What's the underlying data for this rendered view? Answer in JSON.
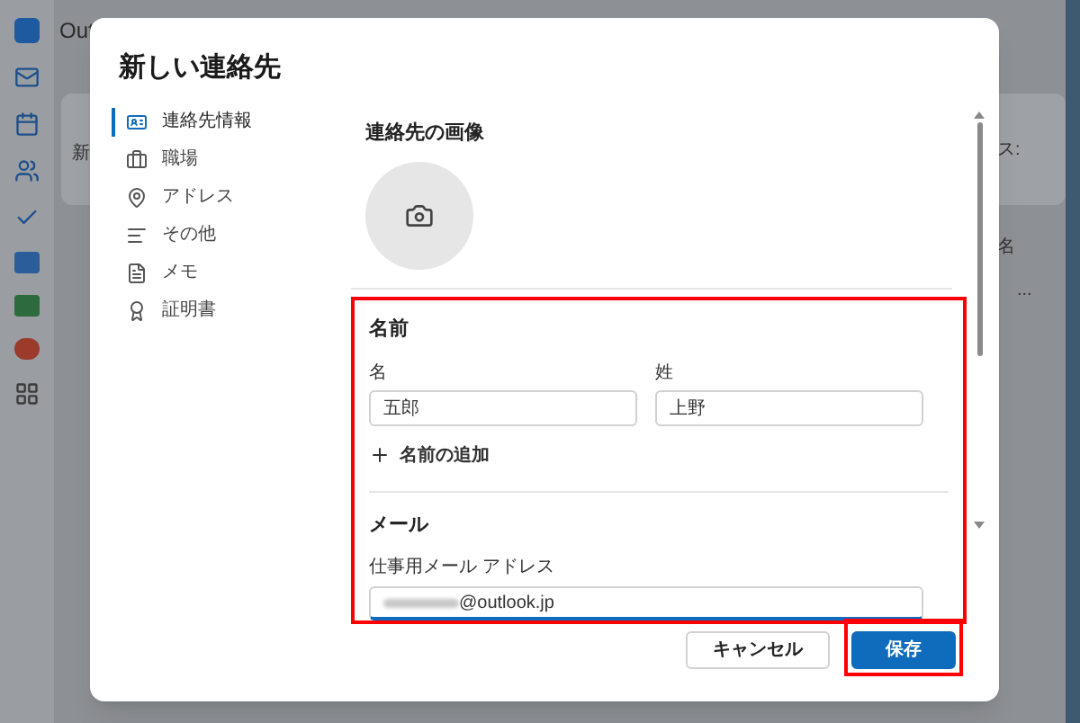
{
  "background": {
    "app_title": "Out",
    "texts": [
      "新",
      "ス:",
      "名",
      "..."
    ]
  },
  "dialog": {
    "title": "新しい連絡先",
    "nav": [
      {
        "label": "連絡先情報",
        "selected": true
      },
      {
        "label": "職場",
        "selected": false
      },
      {
        "label": "アドレス",
        "selected": false
      },
      {
        "label": "その他",
        "selected": false
      },
      {
        "label": "メモ",
        "selected": false
      },
      {
        "label": "証明書",
        "selected": false
      }
    ],
    "photo_section": {
      "title": "連絡先の画像"
    },
    "name_section": {
      "title": "名前",
      "highlighted": true,
      "first_name": {
        "label": "名",
        "value": "五郎"
      },
      "last_name": {
        "label": "姓",
        "value": "上野"
      },
      "add_name": "名前の追加"
    },
    "email_section": {
      "title": "メール",
      "label": "仕事用メール アドレス",
      "value": "@outlook.jp"
    },
    "buttons": [
      {
        "label": "キャンセル",
        "kind": "secondary",
        "highlighted": false
      },
      {
        "label": "保存",
        "kind": "primary",
        "highlighted": true
      }
    ]
  }
}
